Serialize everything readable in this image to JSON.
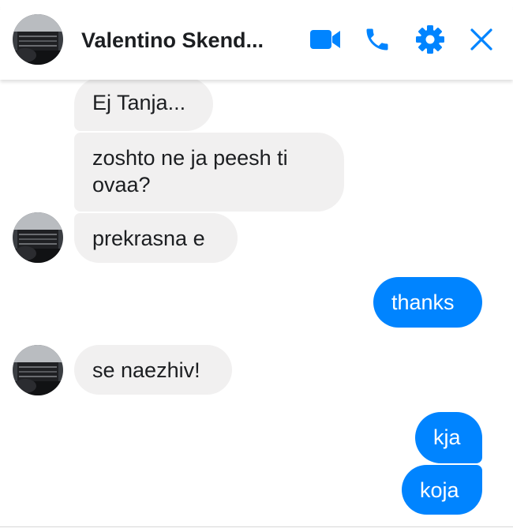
{
  "header": {
    "contact_name": "Valentino Skend...",
    "icons": {
      "video": "video-camera-icon",
      "call": "phone-icon",
      "settings": "gear-icon",
      "close": "close-icon"
    }
  },
  "colors": {
    "accent": "#0084ff",
    "incoming_bubble": "#f1f0f0",
    "text": "#1c1e21"
  },
  "messages": [
    {
      "direction": "incoming",
      "text": "Ej Tanja..."
    },
    {
      "direction": "incoming",
      "text": "zoshto ne ja peesh ti ovaa?"
    },
    {
      "direction": "incoming",
      "text": "prekrasna e"
    },
    {
      "direction": "outgoing",
      "text": "thanks"
    },
    {
      "direction": "incoming",
      "text": "se naezhiv!"
    },
    {
      "direction": "outgoing",
      "text": "kja"
    },
    {
      "direction": "outgoing",
      "text": "koja"
    }
  ]
}
